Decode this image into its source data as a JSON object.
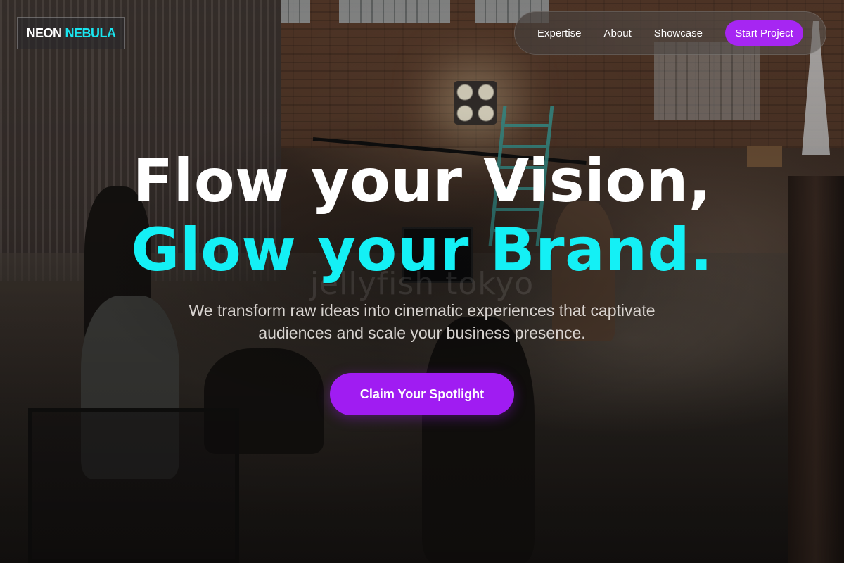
{
  "brand": {
    "word1": "NEON",
    "word2": "NEBULA"
  },
  "nav": {
    "links": [
      "Expertise",
      "About",
      "Showcase"
    ],
    "cta_label": "Start Project"
  },
  "hero": {
    "title_line1": "Flow your Vision,",
    "title_line2": "Glow your Brand.",
    "subtitle": "We transform raw ideas into cinematic experiences that captivate audiences and scale your business presence.",
    "cta_label": "Claim Your Spotlight"
  },
  "background": {
    "watermark": "jellyfish tokyo"
  },
  "colors": {
    "accent_cyan": "#14f0f5",
    "accent_purple": "#a626f2"
  }
}
